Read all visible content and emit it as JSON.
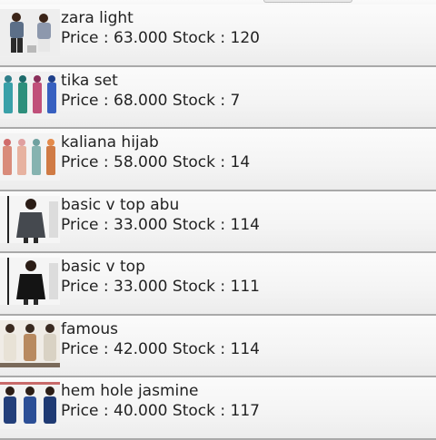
{
  "labels": {
    "price": "Price :",
    "stock": "Stock :"
  },
  "products": [
    {
      "name": "zara light",
      "price": "63.000",
      "stock": "120"
    },
    {
      "name": "tika set",
      "price": "68.000",
      "stock": "7"
    },
    {
      "name": "kaliana hijab",
      "price": "58.000",
      "stock": "14"
    },
    {
      "name": "basic v top abu",
      "price": "33.000",
      "stock": "114"
    },
    {
      "name": "basic v top",
      "price": "33.000",
      "stock": "111"
    },
    {
      "name": "famous",
      "price": "42.000",
      "stock": "114"
    },
    {
      "name": "hem hole jasmine",
      "price": "40.000",
      "stock": "117"
    }
  ]
}
